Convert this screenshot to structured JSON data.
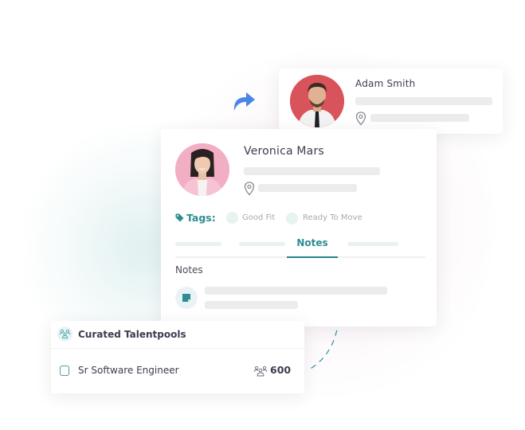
{
  "adam_card": {
    "name": "Adam Smith",
    "avatar_bg": "#d9535a"
  },
  "veronica_card": {
    "name": "Veronica Mars",
    "avatar_bg": "#f2afc4",
    "tags_label": "Tags:",
    "tags": [
      "Good Fit",
      "Ready To Move"
    ],
    "tabs": {
      "active_label": "Notes"
    },
    "notes_heading": "Notes"
  },
  "talentpools_card": {
    "title": "Curated Talentpools",
    "items": [
      {
        "label": "Sr Software Engineer",
        "count": "600",
        "checked": false
      }
    ]
  },
  "icons": {
    "share": "share-arrow-icon",
    "location": "location-pin-icon",
    "tag": "tag-icon",
    "note": "sticky-note-icon",
    "group": "group-users-icon"
  },
  "colors": {
    "accent_teal": "#2c8e92",
    "share_arrow_blue": "#4a86e8",
    "skeleton": "#ececec",
    "skeleton_teal": "#e6f3f1"
  }
}
